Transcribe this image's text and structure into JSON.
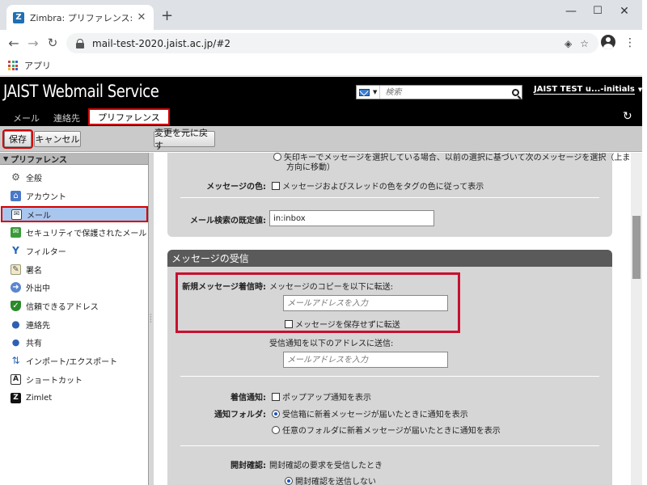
{
  "browser": {
    "tab_title": "Zimbra: プリファレンス: メール",
    "tab_close": "✕",
    "new_tab": "+",
    "url": "mail-test-2020.jaist.ac.jp/#2",
    "bookmark_apps_label": "アプリ"
  },
  "header": {
    "logo": "JAIST Webmail Service",
    "search_placeholder": "検索",
    "user": "JAIST TEST u...-initials"
  },
  "app_tabs": [
    "メール",
    "連絡先",
    "プリファレンス"
  ],
  "toolbar": {
    "save_label": "保存",
    "cancel_label": "キャンセル",
    "revert_label": "変更を元に戻す"
  },
  "sidebar": {
    "title": "プリファレンス",
    "items": [
      {
        "label": "全般",
        "icon": "gear-icon"
      },
      {
        "label": "アカウント",
        "icon": "account-icon"
      },
      {
        "label": "メール",
        "icon": "mail-icon"
      },
      {
        "label": "セキュリティで保護されたメール",
        "icon": "secure-mail-icon"
      },
      {
        "label": "フィルター",
        "icon": "filter-icon"
      },
      {
        "label": "署名",
        "icon": "signature-icon"
      },
      {
        "label": "外出中",
        "icon": "out-of-office-icon"
      },
      {
        "label": "信頼できるアドレス",
        "icon": "shield-icon"
      },
      {
        "label": "連絡先",
        "icon": "contact-icon"
      },
      {
        "label": "共有",
        "icon": "share-icon"
      },
      {
        "label": "インポート/エクスポート",
        "icon": "import-export-icon"
      },
      {
        "label": "ショートカット",
        "icon": "shortcut-icon"
      },
      {
        "label": "Zimlet",
        "icon": "zimlet-icon"
      }
    ]
  },
  "settings_top": {
    "arrow_option_line1": "矢印キーでメッセージを選択している場合、以前の選択に基づいて次のメッセージを選択（上または下",
    "arrow_option_line2": "方向に移動）",
    "message_color_label": "メッセージの色:",
    "message_color_option": "メッセージおよびスレッドの色をタグの色に従って表示",
    "default_search_label": "メール検索の既定値:",
    "default_search_value": "in:inbox"
  },
  "receive_section": {
    "title": "メッセージの受信",
    "new_message_label": "新規メッセージ着信時:",
    "forward_copy_text": "メッセージのコピーを以下に転送:",
    "forward_placeholder": "メールアドレスを入力",
    "no_save_option": "メッセージを保存せずに転送",
    "notify_text": "受信通知を以下のアドレスに送信:",
    "notify_placeholder": "メールアドレスを入力",
    "incoming_label": "着信通知:",
    "popup_option": "ポップアップ通知を表示",
    "notify_folder_label": "通知フォルダ:",
    "folder_inbox_option": "受信箱に新着メッセージが届いたときに通知を表示",
    "folder_any_option": "任意のフォルダに新着メッセージが届いたときに通知を表示",
    "read_receipt_label": "開封確認:",
    "read_receipt_text": "開封確認の要求を受信したとき",
    "read_receipt_option": "開封確認を送信しない"
  }
}
